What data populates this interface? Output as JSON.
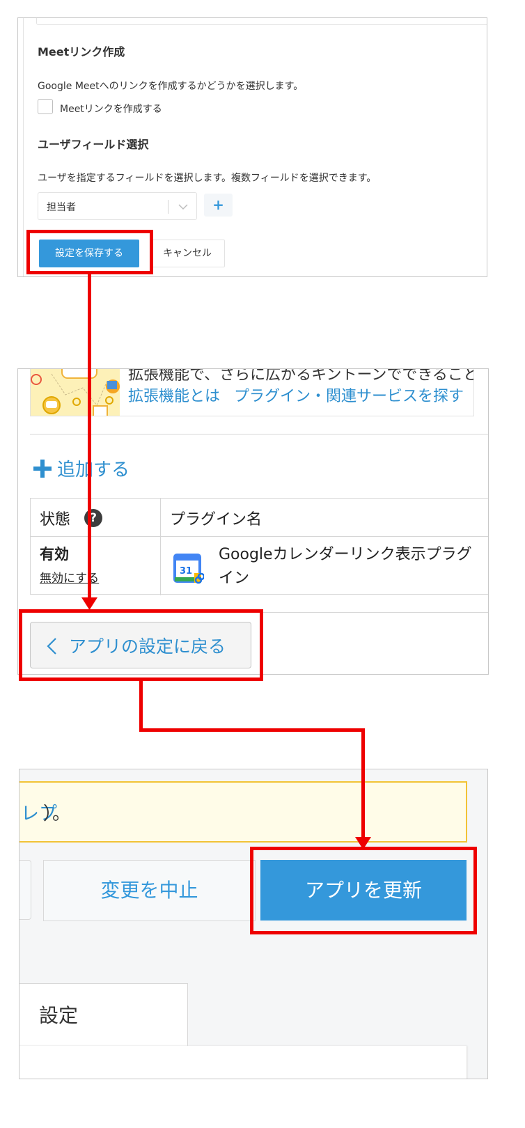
{
  "panel1": {
    "meet_section_title": "Meetリンク作成",
    "meet_section_desc": "Google Meetへのリンクを作成するかどうかを選択します。",
    "meet_checkbox_label": "Meetリンクを作成する",
    "meet_checkbox_checked": false,
    "user_field_title": "ユーザフィールド選択",
    "user_field_desc": "ユーザを指定するフィールドを選択します。複数フィールドを選択できます。",
    "user_field_selected": "担当者",
    "add_field_label": "+",
    "save_label": "設定を保存する",
    "cancel_label": "キャンセル"
  },
  "panel2": {
    "banner_text": "拡張機能で、さらに広がるキントーンでできること",
    "link_about": "拡張機能とは",
    "link_find": "プラグイン・関連サービスを探す",
    "add_label": "追加する",
    "table": {
      "col_status": "状態",
      "col_name": "プラグイン名",
      "status_value": "有効",
      "disable_link": "無効にする",
      "plugin_name_line1": "Googleカレンダーリンク表示プラグ",
      "plugin_name_line2": "イン",
      "plugin_icon_text": "31"
    },
    "back_label": "アプリの設定に戻る"
  },
  "panel3": {
    "notice_text": "レプ）。",
    "discard_label": "変更を中止",
    "update_label": "アプリを更新",
    "tab_label": "設定"
  },
  "colors": {
    "accent": "#3498db",
    "annotation": "#ee0000",
    "notice_border": "#f2c335"
  }
}
